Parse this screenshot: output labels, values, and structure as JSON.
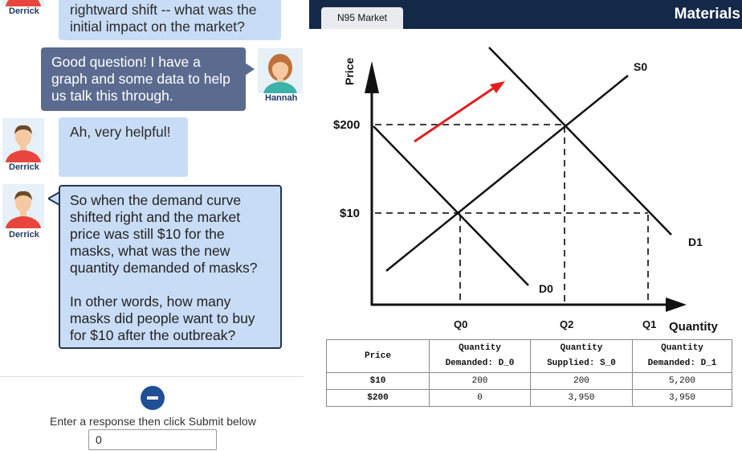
{
  "chat": {
    "msg1": {
      "author": "Derrick",
      "line1": "rightward shift -- what was the",
      "line2": "initial impact on the market?"
    },
    "msg2": {
      "author": "Hannah",
      "line1": "Good question!  I have a",
      "line2": "graph and some data to help",
      "line3": "us talk this through."
    },
    "msg3": {
      "author": "Derrick",
      "line1": "Ah, very helpful!"
    },
    "msg4": {
      "author": "Derrick",
      "line1": "So when the demand curve",
      "line2": "shifted right and the market",
      "line3": "price was still $10 for the",
      "line4": "masks, what was the new",
      "line5": "quantity demanded of masks?",
      "line6": "In other words, how many",
      "line7": "masks did people want to buy",
      "line8": "for $10 after the outbreak?"
    }
  },
  "response": {
    "prompt": "Enter a response then click Submit below",
    "value": "0"
  },
  "materials": {
    "title": "Materials",
    "tab": "N95 Market"
  },
  "chart_data": {
    "type": "line",
    "ylabel": "Price",
    "xlabel": "Quantity",
    "y_ticks": [
      "$200",
      "$10"
    ],
    "x_ticks": [
      "Q0",
      "Q2",
      "Q1"
    ],
    "series": [
      {
        "name": "S0",
        "color": "#111111"
      },
      {
        "name": "D0",
        "color": "#111111"
      },
      {
        "name": "D1",
        "color": "#111111"
      }
    ],
    "arrow_color": "#e02020"
  },
  "table": {
    "headers": [
      "Price",
      "Quantity Demanded: D_0",
      "Quantity Supplied: S_0",
      "Quantity Demanded: D_1"
    ],
    "head_lines": [
      [
        "Price"
      ],
      [
        "Quantity",
        "Demanded: D_0"
      ],
      [
        "Quantity",
        "Supplied: S_0"
      ],
      [
        "Quantity",
        "Demanded: D_1"
      ]
    ],
    "rows": [
      [
        "$10",
        "200",
        "200",
        "5,200"
      ],
      [
        "$200",
        "0",
        "3,950",
        "3,950"
      ]
    ]
  }
}
